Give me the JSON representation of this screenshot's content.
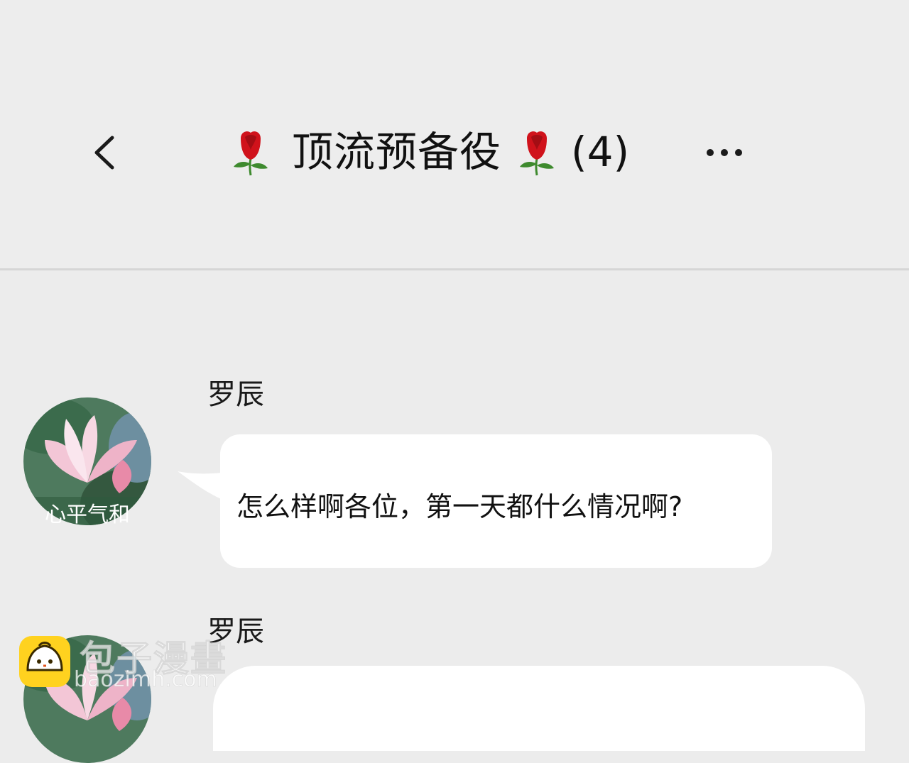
{
  "header": {
    "title": "顶流预备役",
    "count": "(4)",
    "back_icon": "chevron-left-icon",
    "more_icon": "more-horizontal-icon",
    "title_emoji": "rose-icon"
  },
  "messages": [
    {
      "sender": "罗辰",
      "avatar_caption": "心平气和",
      "text": "怎么样啊各位，第一天都什么情况啊?"
    },
    {
      "sender": "罗辰",
      "avatar_caption": "",
      "text": ""
    }
  ],
  "watermark": {
    "brand": "包子漫畫",
    "url": "baozimh.com"
  },
  "colors": {
    "background": "#ececec",
    "bubble": "#ffffff",
    "divider": "#d6d6d6",
    "rose": "#d0121b",
    "leaf": "#3e8a2e",
    "watermark_icon": "#ffd21f"
  }
}
